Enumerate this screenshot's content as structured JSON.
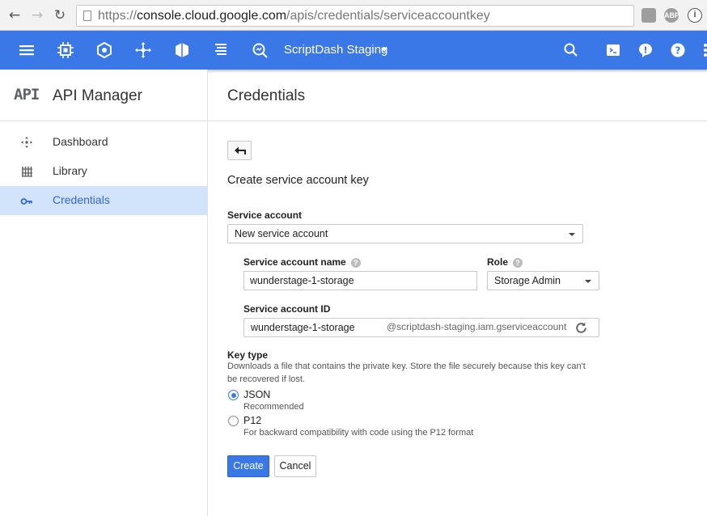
{
  "browser": {
    "url_scheme": "https://",
    "url_host": "console.cloud.google.com",
    "url_path": "/apis/credentials/serviceaccountkey",
    "ext_abp": "ABP",
    "ext_info": "i"
  },
  "appbar": {
    "project_name": "ScriptDash Staging",
    "color": "#3b78e7"
  },
  "sidebar": {
    "logo": "API",
    "title": "API Manager",
    "items": [
      {
        "label": "Dashboard",
        "icon": "dashboard-icon",
        "active": false
      },
      {
        "label": "Library",
        "icon": "library-icon",
        "active": false
      },
      {
        "label": "Credentials",
        "icon": "key-icon",
        "active": true
      }
    ]
  },
  "main": {
    "title": "Credentials",
    "section_title": "Create service account key",
    "service_account_label": "Service account",
    "service_account_value": "New service account",
    "account_name_label": "Service account name",
    "account_name_value": "wunderstage-1-storage",
    "role_label": "Role",
    "role_value": "Storage Admin",
    "account_id_label": "Service account ID",
    "account_id_value": "wunderstage-1-storage",
    "account_id_suffix": "@scriptdash-staging.iam.gserviceaccount",
    "key_type_label": "Key type",
    "key_type_desc": "Downloads a file that contains the private key. Store the file securely because this key can't be recovered if lost.",
    "options": [
      {
        "label": "JSON",
        "sub": "Recommended",
        "selected": true
      },
      {
        "label": "P12",
        "sub": "For backward compatibility with code using the P12 format",
        "selected": false
      }
    ],
    "help_glyph": "?",
    "create_label": "Create",
    "cancel_label": "Cancel"
  }
}
